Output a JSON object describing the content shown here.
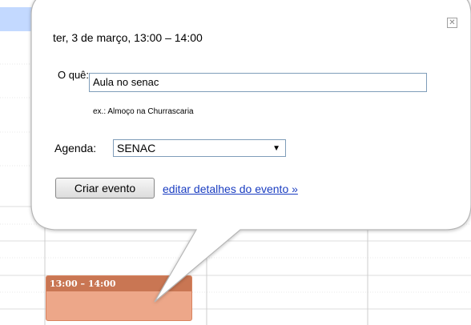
{
  "popup": {
    "title": "ter, 3 de março, 13:00 – 14:00",
    "what_label": "O quê:",
    "what_value": "Aula no senac",
    "example_hint": "ex.: Almoço na Churrascaria",
    "agenda_label": "Agenda:",
    "agenda_value": "SENAC",
    "create_button": "Criar evento",
    "edit_link": "editar detalhes do evento »",
    "close_icon": "close-icon"
  },
  "calendar": {
    "event_time": "13:00 – 14:00"
  },
  "colors": {
    "event_fill": "#eda789",
    "event_header": "#c97653",
    "header_strip": "#c3d9ff",
    "link": "#1a3dc1"
  }
}
